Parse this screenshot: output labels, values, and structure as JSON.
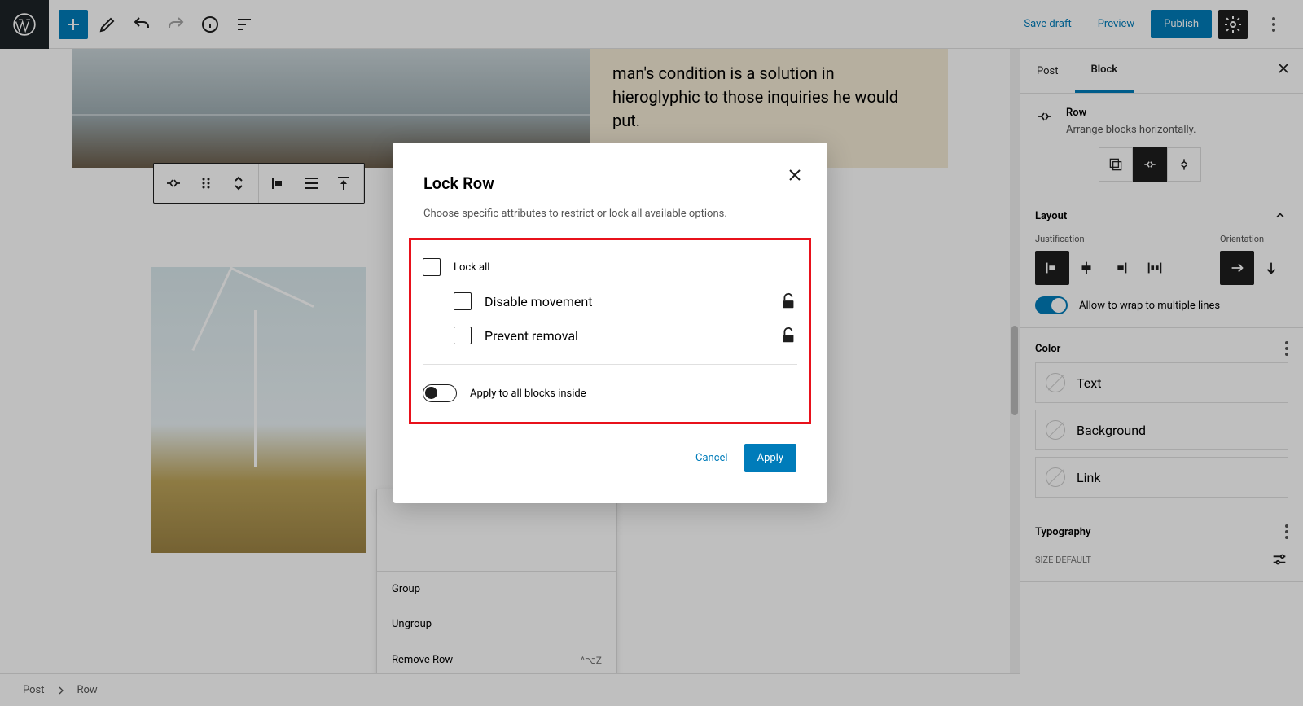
{
  "topbar": {
    "save_draft": "Save draft",
    "preview": "Preview",
    "publish": "Publish"
  },
  "hero_text": "man's condition is a solution in hieroglyphic to those inquiries he would put.",
  "context_menu": {
    "group": "Group",
    "ungroup": "Ungroup",
    "remove": "Remove Row",
    "remove_shortcut": "^⌥Z"
  },
  "sidebar": {
    "tab_post": "Post",
    "tab_block": "Block",
    "block_name": "Row",
    "block_desc": "Arrange blocks horizontally.",
    "layout": "Layout",
    "justification": "Justification",
    "orientation": "Orientation",
    "wrap_label": "Allow to wrap to multiple lines",
    "color": "Color",
    "color_text": "Text",
    "color_bg": "Background",
    "color_link": "Link",
    "typography": "Typography",
    "size": "SIZE",
    "size_default": "DEFAULT"
  },
  "breadcrumb": {
    "post": "Post",
    "row": "Row"
  },
  "modal": {
    "title": "Lock Row",
    "description": "Choose specific attributes to restrict or lock all available options.",
    "lock_all": "Lock all",
    "disable_movement": "Disable movement",
    "prevent_removal": "Prevent removal",
    "apply_inside": "Apply to all blocks inside",
    "cancel": "Cancel",
    "apply": "Apply"
  }
}
